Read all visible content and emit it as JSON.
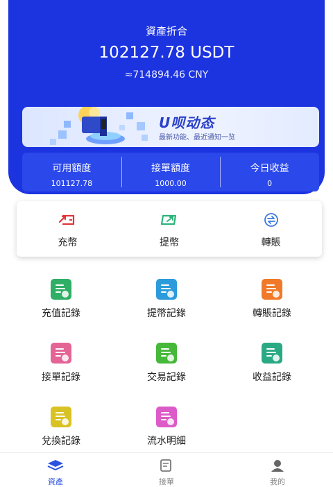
{
  "hero": {
    "title": "資產折合",
    "usdt": "102127.78 USDT",
    "cny": "≈714894.46 CNY"
  },
  "banner": {
    "title": "U呗动态",
    "subtitle": "最新功能、最近通知一览"
  },
  "stats": [
    {
      "label": "可用額度",
      "value": "101127.78"
    },
    {
      "label": "接單額度",
      "value": "1000.00"
    },
    {
      "label": "今日收益",
      "value": "0"
    }
  ],
  "actions": [
    {
      "label": "充幣",
      "icon": "deposit-icon",
      "color": "#e0343a"
    },
    {
      "label": "提幣",
      "icon": "withdraw-icon",
      "color": "#2db37a"
    },
    {
      "label": "轉賬",
      "icon": "transfer-icon",
      "color": "#3a78e0"
    }
  ],
  "records": [
    {
      "label": "充值記錄",
      "color": "#2fae66"
    },
    {
      "label": "提幣記錄",
      "color": "#2b9bdc"
    },
    {
      "label": "轉賬記錄",
      "color": "#f07a2a"
    },
    {
      "label": "接單記錄",
      "color": "#e46496"
    },
    {
      "label": "交易記錄",
      "color": "#46b83a"
    },
    {
      "label": "收益記錄",
      "color": "#2aa985"
    },
    {
      "label": "兌換記錄",
      "color": "#d9c223"
    },
    {
      "label": "流水明細",
      "color": "#dc5bc8"
    }
  ],
  "tabs": [
    {
      "label": "資產",
      "icon": "layers-icon",
      "active": true,
      "color": "#2d52e0"
    },
    {
      "label": "接單",
      "icon": "orders-icon",
      "active": false,
      "color": "#888888"
    },
    {
      "label": "我的",
      "icon": "user-icon",
      "active": false,
      "color": "#888888"
    }
  ]
}
